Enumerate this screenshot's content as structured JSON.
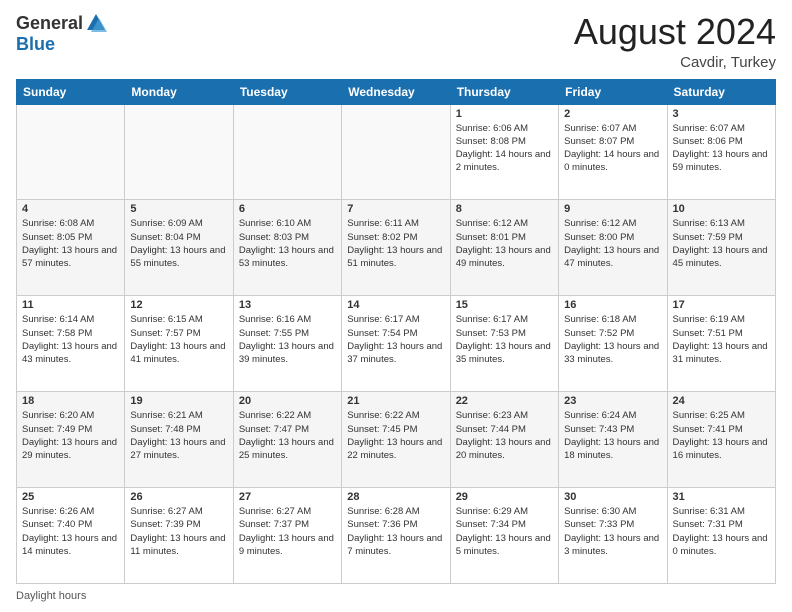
{
  "header": {
    "logo": {
      "general": "General",
      "blue": "Blue",
      "tagline": ""
    },
    "month_title": "August 2024",
    "location": "Cavdir, Turkey"
  },
  "days_of_week": [
    "Sunday",
    "Monday",
    "Tuesday",
    "Wednesday",
    "Thursday",
    "Friday",
    "Saturday"
  ],
  "weeks": [
    [
      {
        "day": "",
        "sunrise": "",
        "sunset": "",
        "daylight": ""
      },
      {
        "day": "",
        "sunrise": "",
        "sunset": "",
        "daylight": ""
      },
      {
        "day": "",
        "sunrise": "",
        "sunset": "",
        "daylight": ""
      },
      {
        "day": "",
        "sunrise": "",
        "sunset": "",
        "daylight": ""
      },
      {
        "day": "1",
        "sunrise": "Sunrise: 6:06 AM",
        "sunset": "Sunset: 8:08 PM",
        "daylight": "Daylight: 14 hours and 2 minutes."
      },
      {
        "day": "2",
        "sunrise": "Sunrise: 6:07 AM",
        "sunset": "Sunset: 8:07 PM",
        "daylight": "Daylight: 14 hours and 0 minutes."
      },
      {
        "day": "3",
        "sunrise": "Sunrise: 6:07 AM",
        "sunset": "Sunset: 8:06 PM",
        "daylight": "Daylight: 13 hours and 59 minutes."
      }
    ],
    [
      {
        "day": "4",
        "sunrise": "Sunrise: 6:08 AM",
        "sunset": "Sunset: 8:05 PM",
        "daylight": "Daylight: 13 hours and 57 minutes."
      },
      {
        "day": "5",
        "sunrise": "Sunrise: 6:09 AM",
        "sunset": "Sunset: 8:04 PM",
        "daylight": "Daylight: 13 hours and 55 minutes."
      },
      {
        "day": "6",
        "sunrise": "Sunrise: 6:10 AM",
        "sunset": "Sunset: 8:03 PM",
        "daylight": "Daylight: 13 hours and 53 minutes."
      },
      {
        "day": "7",
        "sunrise": "Sunrise: 6:11 AM",
        "sunset": "Sunset: 8:02 PM",
        "daylight": "Daylight: 13 hours and 51 minutes."
      },
      {
        "day": "8",
        "sunrise": "Sunrise: 6:12 AM",
        "sunset": "Sunset: 8:01 PM",
        "daylight": "Daylight: 13 hours and 49 minutes."
      },
      {
        "day": "9",
        "sunrise": "Sunrise: 6:12 AM",
        "sunset": "Sunset: 8:00 PM",
        "daylight": "Daylight: 13 hours and 47 minutes."
      },
      {
        "day": "10",
        "sunrise": "Sunrise: 6:13 AM",
        "sunset": "Sunset: 7:59 PM",
        "daylight": "Daylight: 13 hours and 45 minutes."
      }
    ],
    [
      {
        "day": "11",
        "sunrise": "Sunrise: 6:14 AM",
        "sunset": "Sunset: 7:58 PM",
        "daylight": "Daylight: 13 hours and 43 minutes."
      },
      {
        "day": "12",
        "sunrise": "Sunrise: 6:15 AM",
        "sunset": "Sunset: 7:57 PM",
        "daylight": "Daylight: 13 hours and 41 minutes."
      },
      {
        "day": "13",
        "sunrise": "Sunrise: 6:16 AM",
        "sunset": "Sunset: 7:55 PM",
        "daylight": "Daylight: 13 hours and 39 minutes."
      },
      {
        "day": "14",
        "sunrise": "Sunrise: 6:17 AM",
        "sunset": "Sunset: 7:54 PM",
        "daylight": "Daylight: 13 hours and 37 minutes."
      },
      {
        "day": "15",
        "sunrise": "Sunrise: 6:17 AM",
        "sunset": "Sunset: 7:53 PM",
        "daylight": "Daylight: 13 hours and 35 minutes."
      },
      {
        "day": "16",
        "sunrise": "Sunrise: 6:18 AM",
        "sunset": "Sunset: 7:52 PM",
        "daylight": "Daylight: 13 hours and 33 minutes."
      },
      {
        "day": "17",
        "sunrise": "Sunrise: 6:19 AM",
        "sunset": "Sunset: 7:51 PM",
        "daylight": "Daylight: 13 hours and 31 minutes."
      }
    ],
    [
      {
        "day": "18",
        "sunrise": "Sunrise: 6:20 AM",
        "sunset": "Sunset: 7:49 PM",
        "daylight": "Daylight: 13 hours and 29 minutes."
      },
      {
        "day": "19",
        "sunrise": "Sunrise: 6:21 AM",
        "sunset": "Sunset: 7:48 PM",
        "daylight": "Daylight: 13 hours and 27 minutes."
      },
      {
        "day": "20",
        "sunrise": "Sunrise: 6:22 AM",
        "sunset": "Sunset: 7:47 PM",
        "daylight": "Daylight: 13 hours and 25 minutes."
      },
      {
        "day": "21",
        "sunrise": "Sunrise: 6:22 AM",
        "sunset": "Sunset: 7:45 PM",
        "daylight": "Daylight: 13 hours and 22 minutes."
      },
      {
        "day": "22",
        "sunrise": "Sunrise: 6:23 AM",
        "sunset": "Sunset: 7:44 PM",
        "daylight": "Daylight: 13 hours and 20 minutes."
      },
      {
        "day": "23",
        "sunrise": "Sunrise: 6:24 AM",
        "sunset": "Sunset: 7:43 PM",
        "daylight": "Daylight: 13 hours and 18 minutes."
      },
      {
        "day": "24",
        "sunrise": "Sunrise: 6:25 AM",
        "sunset": "Sunset: 7:41 PM",
        "daylight": "Daylight: 13 hours and 16 minutes."
      }
    ],
    [
      {
        "day": "25",
        "sunrise": "Sunrise: 6:26 AM",
        "sunset": "Sunset: 7:40 PM",
        "daylight": "Daylight: 13 hours and 14 minutes."
      },
      {
        "day": "26",
        "sunrise": "Sunrise: 6:27 AM",
        "sunset": "Sunset: 7:39 PM",
        "daylight": "Daylight: 13 hours and 11 minutes."
      },
      {
        "day": "27",
        "sunrise": "Sunrise: 6:27 AM",
        "sunset": "Sunset: 7:37 PM",
        "daylight": "Daylight: 13 hours and 9 minutes."
      },
      {
        "day": "28",
        "sunrise": "Sunrise: 6:28 AM",
        "sunset": "Sunset: 7:36 PM",
        "daylight": "Daylight: 13 hours and 7 minutes."
      },
      {
        "day": "29",
        "sunrise": "Sunrise: 6:29 AM",
        "sunset": "Sunset: 7:34 PM",
        "daylight": "Daylight: 13 hours and 5 minutes."
      },
      {
        "day": "30",
        "sunrise": "Sunrise: 6:30 AM",
        "sunset": "Sunset: 7:33 PM",
        "daylight": "Daylight: 13 hours and 3 minutes."
      },
      {
        "day": "31",
        "sunrise": "Sunrise: 6:31 AM",
        "sunset": "Sunset: 7:31 PM",
        "daylight": "Daylight: 13 hours and 0 minutes."
      }
    ]
  ],
  "footer": {
    "daylight_label": "Daylight hours"
  }
}
